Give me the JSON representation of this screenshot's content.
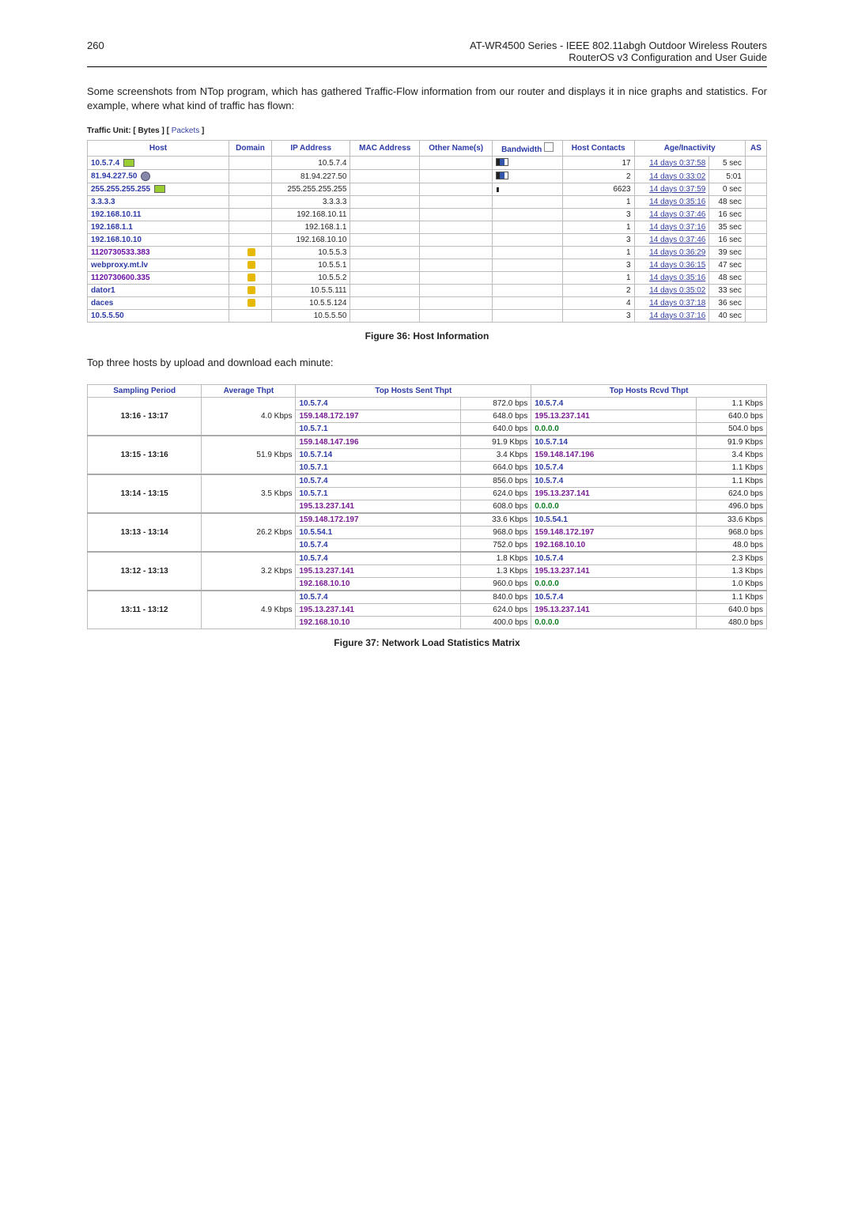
{
  "header": {
    "page_number": "260",
    "title_line1": "AT-WR4500 Series - IEEE 802.11abgh Outdoor Wireless Routers",
    "title_line2": "RouterOS v3 Configuration and User Guide"
  },
  "body": {
    "paragraph": "Some screenshots from NTop program, which has gathered Traffic-Flow information from our router and displays it in nice graphs and statistics. For example, where what kind of traffic has flown:"
  },
  "traffic_unit": {
    "label": "Traffic Unit:",
    "bytes": "Bytes",
    "packets": "Packets"
  },
  "host_table": {
    "headers": [
      "Host",
      "Domain",
      "IP Address",
      "MAC Address",
      "Other Name(s)",
      "Bandwidth",
      "Host Contacts",
      "Age/Inactivity",
      "AS"
    ],
    "rows": [
      {
        "host": "10.5.7.4",
        "type": "flag",
        "ip": "10.5.7.4",
        "contacts": "17",
        "age": "14 days 0:37:58",
        "inact": "5 sec",
        "bw": "blue"
      },
      {
        "host": "81.94.227.50",
        "type": "globe",
        "ip": "81.94.227.50",
        "contacts": "2",
        "age": "14 days 0:33:02",
        "inact": "5:01",
        "bw": "blue"
      },
      {
        "host": "255.255.255.255",
        "type": "flag",
        "ip": "255.255.255.255",
        "contacts": "6623",
        "age": "14 days 0:37:59",
        "inact": "0 sec",
        "bw": "dotted"
      },
      {
        "host": "3.3.3.3",
        "type": "",
        "ip": "3.3.3.3",
        "contacts": "1",
        "age": "14 days 0:35:16",
        "inact": "48 sec"
      },
      {
        "host": "192.168.10.11",
        "type": "",
        "ip": "192.168.10.11",
        "contacts": "3",
        "age": "14 days 0:37:46",
        "inact": "16 sec"
      },
      {
        "host": "192.168.1.1",
        "type": "",
        "ip": "192.168.1.1",
        "contacts": "1",
        "age": "14 days 0:37:16",
        "inact": "35 sec"
      },
      {
        "host": "192.168.10.10",
        "type": "",
        "ip": "192.168.10.10",
        "contacts": "3",
        "age": "14 days 0:37:46",
        "inact": "16 sec"
      },
      {
        "host": "1120730533.383",
        "type": "local",
        "purple": true,
        "ip": "10.5.5.3",
        "contacts": "1",
        "age": "14 days 0:36:29",
        "inact": "39 sec"
      },
      {
        "host": "webproxy.mt.lv",
        "type": "local",
        "ip": "10.5.5.1",
        "contacts": "3",
        "age": "14 days 0:36:15",
        "inact": "47 sec"
      },
      {
        "host": "1120730600.335",
        "type": "local",
        "purple": true,
        "ip": "10.5.5.2",
        "contacts": "1",
        "age": "14 days 0:35:16",
        "inact": "48 sec"
      },
      {
        "host": "dator1",
        "type": "local",
        "ip": "10.5.5.111",
        "contacts": "2",
        "age": "14 days 0:35:02",
        "inact": "33 sec"
      },
      {
        "host": "daces",
        "type": "local",
        "ip": "10.5.5.124",
        "contacts": "4",
        "age": "14 days 0:37:18",
        "inact": "36 sec"
      },
      {
        "host": "10.5.5.50",
        "type": "",
        "ip": "10.5.5.50",
        "contacts": "3",
        "age": "14 days 0:37:16",
        "inact": "40 sec"
      }
    ]
  },
  "figure36": "Figure 36: Host Information",
  "between_text": "Top three hosts by upload and download each minute:",
  "thpt_table": {
    "headers": {
      "period": "Sampling Period",
      "avg": "Average Thpt",
      "sent": "Top Hosts Sent Thpt",
      "rcvd": "Top Hosts Rcvd Thpt"
    },
    "blocks": [
      {
        "period": "13:16 - 13:17",
        "avg": "4.0 Kbps",
        "sent": [
          {
            "ip": "10.5.7.4",
            "amt": "872.0 bps"
          },
          {
            "ip": "159.148.172.197",
            "amt": "648.0 bps",
            "cls": "purple"
          },
          {
            "ip": "10.5.7.1",
            "amt": "640.0 bps"
          }
        ],
        "rcvd": [
          {
            "ip": "10.5.7.4",
            "amt": "1.1 Kbps"
          },
          {
            "ip": "195.13.237.141",
            "amt": "640.0 bps",
            "cls": "purple"
          },
          {
            "ip": "0.0.0.0",
            "amt": "504.0 bps",
            "cls": "green"
          }
        ]
      },
      {
        "period": "13:15 - 13:16",
        "avg": "51.9 Kbps",
        "sent": [
          {
            "ip": "159.148.147.196",
            "amt": "91.9 Kbps",
            "cls": "purple"
          },
          {
            "ip": "10.5.7.14",
            "amt": "3.4 Kbps"
          },
          {
            "ip": "10.5.7.1",
            "amt": "664.0 bps"
          }
        ],
        "rcvd": [
          {
            "ip": "10.5.7.14",
            "amt": "91.9 Kbps"
          },
          {
            "ip": "159.148.147.196",
            "amt": "3.4 Kbps",
            "cls": "purple"
          },
          {
            "ip": "10.5.7.4",
            "amt": "1.1 Kbps"
          }
        ]
      },
      {
        "period": "13:14 - 13:15",
        "avg": "3.5 Kbps",
        "sent": [
          {
            "ip": "10.5.7.4",
            "amt": "856.0 bps"
          },
          {
            "ip": "10.5.7.1",
            "amt": "624.0 bps"
          },
          {
            "ip": "195.13.237.141",
            "amt": "608.0 bps",
            "cls": "purple"
          }
        ],
        "rcvd": [
          {
            "ip": "10.5.7.4",
            "amt": "1.1 Kbps"
          },
          {
            "ip": "195.13.237.141",
            "amt": "624.0 bps",
            "cls": "purple"
          },
          {
            "ip": "0.0.0.0",
            "amt": "496.0 bps",
            "cls": "green"
          }
        ]
      },
      {
        "period": "13:13 - 13:14",
        "avg": "26.2 Kbps",
        "sent": [
          {
            "ip": "159.148.172.197",
            "amt": "33.6 Kbps",
            "cls": "purple"
          },
          {
            "ip": "10.5.54.1",
            "amt": "968.0 bps"
          },
          {
            "ip": "10.5.7.4",
            "amt": "752.0 bps"
          }
        ],
        "rcvd": [
          {
            "ip": "10.5.54.1",
            "amt": "33.6 Kbps"
          },
          {
            "ip": "159.148.172.197",
            "amt": "968.0 bps",
            "cls": "purple"
          },
          {
            "ip": "192.168.10.10",
            "amt": "48.0 bps",
            "cls": "purple"
          }
        ]
      },
      {
        "period": "13:12 - 13:13",
        "avg": "3.2 Kbps",
        "sent": [
          {
            "ip": "10.5.7.4",
            "amt": "1.8 Kbps"
          },
          {
            "ip": "195.13.237.141",
            "amt": "1.3 Kbps",
            "cls": "purple"
          },
          {
            "ip": "192.168.10.10",
            "amt": "960.0 bps",
            "cls": "purple"
          }
        ],
        "rcvd": [
          {
            "ip": "10.5.7.4",
            "amt": "2.3 Kbps"
          },
          {
            "ip": "195.13.237.141",
            "amt": "1.3 Kbps",
            "cls": "purple"
          },
          {
            "ip": "0.0.0.0",
            "amt": "1.0 Kbps",
            "cls": "green"
          }
        ]
      },
      {
        "period": "13:11 - 13:12",
        "avg": "4.9 Kbps",
        "sent": [
          {
            "ip": "10.5.7.4",
            "amt": "840.0 bps"
          },
          {
            "ip": "195.13.237.141",
            "amt": "624.0 bps",
            "cls": "purple"
          },
          {
            "ip": "192.168.10.10",
            "amt": "400.0 bps",
            "cls": "purple"
          }
        ],
        "rcvd": [
          {
            "ip": "10.5.7.4",
            "amt": "1.1 Kbps"
          },
          {
            "ip": "195.13.237.141",
            "amt": "640.0 bps",
            "cls": "purple"
          },
          {
            "ip": "0.0.0.0",
            "amt": "480.0 bps",
            "cls": "green"
          }
        ]
      }
    ]
  },
  "figure37": "Figure 37: Network Load Statistics Matrix"
}
